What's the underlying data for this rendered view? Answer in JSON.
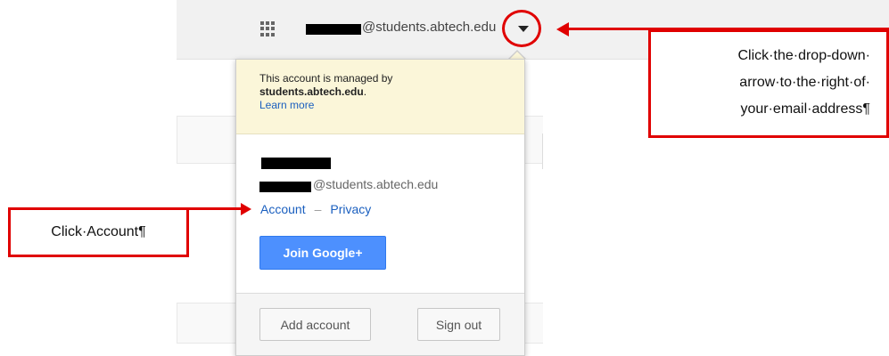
{
  "topbar": {
    "email_suffix": "@students.abtech.edu"
  },
  "popup": {
    "managed_line1": "This account is managed by",
    "managed_domain": "students.abtech.edu",
    "learn_more": "Learn more",
    "email_suffix": "@students.abtech.edu",
    "account_link": "Account",
    "separator": "–",
    "privacy_link": "Privacy",
    "join_button": "Join Google+",
    "add_account_button": "Add account",
    "sign_out_button": "Sign out"
  },
  "callouts": {
    "right_line1": "Click·the·drop-down·",
    "right_line2": "arrow·to·the·right·of·",
    "right_line3": "your·email·address¶",
    "left_text": "Click·Account¶"
  },
  "colors": {
    "annotation_red": "#e00000",
    "link_blue": "#1a5fbf",
    "join_button_blue": "#4d90fe",
    "managed_banner": "#fbf6d9"
  }
}
